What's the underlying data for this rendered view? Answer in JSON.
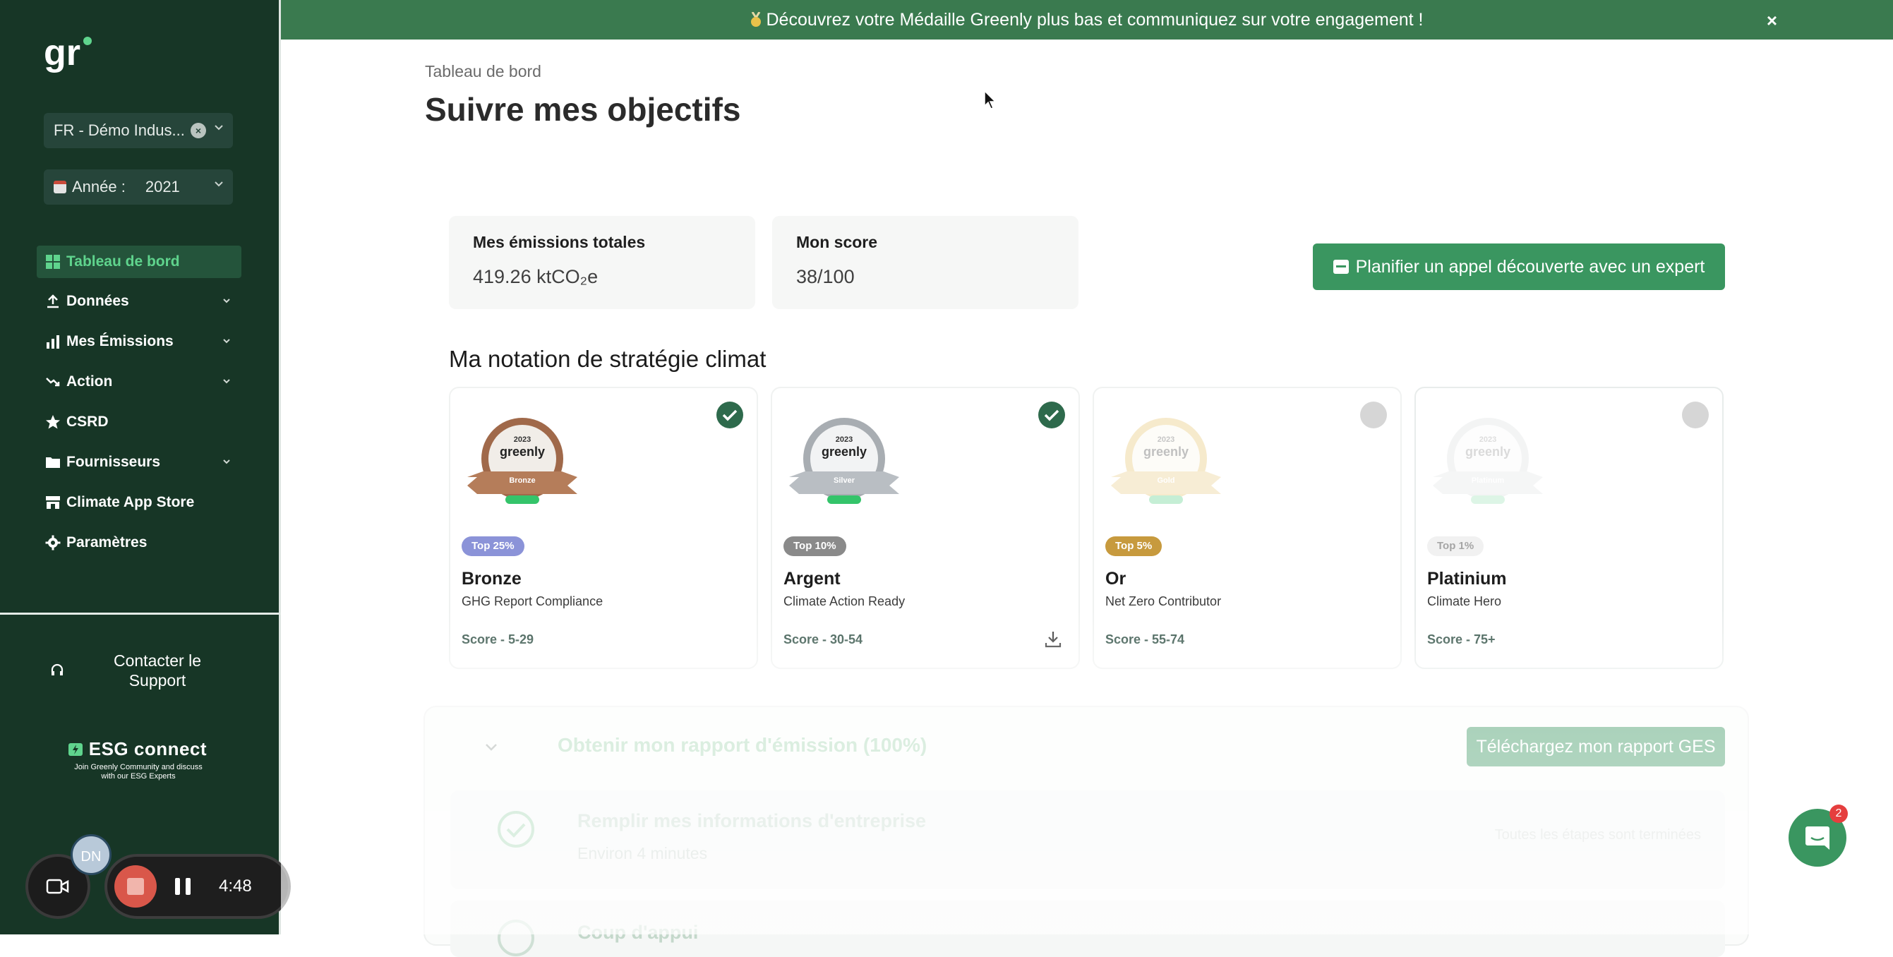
{
  "banner": {
    "text": "Découvrez votre Médaille Greenly plus bas et communiquez sur votre engagement !",
    "close": "×"
  },
  "sidebar": {
    "logo": "gr",
    "company_select": "FR - Démo Indus...",
    "year_label": "Année :",
    "year_value": "2021",
    "items": [
      {
        "label": "Tableau de bord",
        "icon": "grid-icon",
        "active": true
      },
      {
        "label": "Données",
        "icon": "upload-icon"
      },
      {
        "label": "Mes Émissions",
        "icon": "bar-chart-icon"
      },
      {
        "label": "Action",
        "icon": "trend-down-icon"
      },
      {
        "label": "CSRD",
        "icon": "star-icon"
      },
      {
        "label": "Fournisseurs",
        "icon": "folder-icon"
      },
      {
        "label": "Climate App Store",
        "icon": "store-icon"
      },
      {
        "label": "Paramètres",
        "icon": "gear-icon"
      }
    ],
    "support": "Contacter le Support",
    "esg_title": "ESG connect",
    "esg_sub": "Join Greenly Community and discuss with our ESG Experts"
  },
  "recorder": {
    "avatar": "DN",
    "time": "4:48"
  },
  "page": {
    "breadcrumb": "Tableau de bord",
    "title": "Suivre mes objectifs",
    "stats": [
      {
        "label": "Mes émissions totales",
        "value": "419.26 ktCO₂e"
      },
      {
        "label": "Mon score",
        "value": "38/100"
      }
    ],
    "cta": "Planifier un appel découverte avec un expert",
    "rating_title": "Ma notation de stratégie climat",
    "cards": [
      {
        "badge": "Top 25%",
        "name": "Bronze",
        "sub": "GHG Report Compliance",
        "score": "Score - 5-29",
        "achieved": true,
        "badge_color": "#8b93d8",
        "medal_year": "2023",
        "medal_brand": "greenly",
        "medal_tier": "Bronze"
      },
      {
        "badge": "Top 10%",
        "name": "Argent",
        "sub": "Climate Action Ready",
        "score": "Score - 30-54",
        "achieved": true,
        "badge_color": "#8a8a8a",
        "medal_year": "2023",
        "medal_brand": "greenly",
        "medal_tier": "Silver"
      },
      {
        "badge": "Top 5%",
        "name": "Or",
        "sub": "Net Zero Contributor",
        "score": "Score - 55-74",
        "achieved": false,
        "badge_color": "#c79a3e",
        "medal_year": "2023",
        "medal_brand": "greenly",
        "medal_tier": "Gold"
      },
      {
        "badge": "Top 1%",
        "name": "Platinium",
        "sub": "Climate Hero",
        "score": "Score - 75+",
        "achieved": false,
        "badge_color": "#f1f1f1",
        "medal_year": "2023",
        "medal_brand": "greenly",
        "medal_tier": "Platinum"
      }
    ],
    "report": {
      "title": "Obtenir mon rapport d'émission (100%)",
      "button": "Téléchargez mon rapport GES",
      "step1_title": "Remplir mes informations d'entreprise",
      "step1_sub": "Environ 4 minutes",
      "step1_status": "Toutes les étapes sont terminées",
      "step2_title": "Coup d'appui"
    }
  },
  "chat": {
    "badge": "2"
  },
  "colors": {
    "sidebar": "#173626",
    "accent": "#3a9660",
    "banner": "#3a7a4f"
  }
}
